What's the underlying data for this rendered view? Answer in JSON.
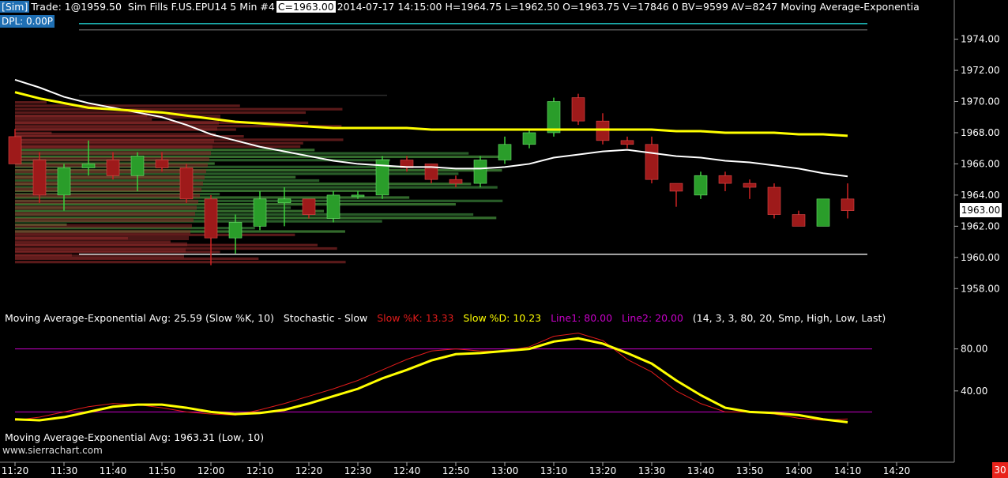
{
  "header": {
    "sim": "[Sim]",
    "trade": "Trade: 1@1959.50",
    "rest": "Sim Fills  F.US.EPU14  5 Min   #4",
    "close": "C=1963.00",
    "stats": "2014-07-17 14:15:00 H=1964.75 L=1962.50 O=1963.75 V=17846 0 BV=9599 AV=8247  Moving Average-Exponentia",
    "dpl": "DPL: 0.00P"
  },
  "indicator_line": {
    "ma": "Moving Average-Exponential  Avg: 25.59   (Slow %K, 10)",
    "stoch": "Stochastic - Slow",
    "k": "Slow %K: 13.33",
    "d": "Slow %D: 10.23",
    "l1": "Line1: 80.00",
    "l2": "Line2: 20.00",
    "params": "(14, 3, 3, 80, 20, Smp, High, Low, Last)"
  },
  "bottom_label": "Moving Average-Exponential  Avg: 1963.31   (Low, 10)",
  "watermark": "www.sierrachart.com",
  "current_price": "1963.00",
  "corner_badge": "30",
  "colors": {
    "up": "#2a9d2a",
    "down": "#9e1a1a",
    "ema_fast": "#ffff00",
    "stoch_k": "#e11b1b",
    "stoch_d": "#ffff00",
    "line1": "#c800c8"
  },
  "chart_data": [
    {
      "type": "candlestick",
      "symbol": "F.US.EPU14",
      "interval": "5 Min",
      "ylim": [
        1957,
        1975.5
      ],
      "y_ticks": [
        "1974.00",
        "1972.00",
        "1970.00",
        "1968.00",
        "1966.00",
        "1964.00",
        "1962.00",
        "1960.00",
        "1958.00"
      ],
      "x_ticks": [
        "11:20",
        "11:30",
        "11:40",
        "11:50",
        "12:00",
        "12:10",
        "12:20",
        "12:30",
        "12:40",
        "12:50",
        "13:00",
        "13:10",
        "13:20",
        "13:30",
        "13:40",
        "13:50",
        "14:00",
        "14:10",
        "14:20"
      ],
      "candles": [
        {
          "t": "11:20",
          "o": 1967.75,
          "h": 1968.25,
          "l": 1966.0,
          "c": 1966.0
        },
        {
          "t": "11:25",
          "o": 1966.25,
          "h": 1966.75,
          "l": 1963.5,
          "c": 1964.0
        },
        {
          "t": "11:30",
          "o": 1964.0,
          "h": 1966.0,
          "l": 1963.0,
          "c": 1965.75
        },
        {
          "t": "11:35",
          "o": 1965.75,
          "h": 1967.5,
          "l": 1965.25,
          "c": 1966.0
        },
        {
          "t": "11:40",
          "o": 1966.25,
          "h": 1966.75,
          "l": 1965.0,
          "c": 1965.25
        },
        {
          "t": "11:45",
          "o": 1965.25,
          "h": 1966.75,
          "l": 1964.25,
          "c": 1966.5
        },
        {
          "t": "11:50",
          "o": 1966.25,
          "h": 1966.75,
          "l": 1965.5,
          "c": 1965.75
        },
        {
          "t": "11:55",
          "o": 1965.75,
          "h": 1966.0,
          "l": 1963.5,
          "c": 1963.75
        },
        {
          "t": "12:00",
          "o": 1963.75,
          "h": 1964.0,
          "l": 1959.5,
          "c": 1961.25
        },
        {
          "t": "12:05",
          "o": 1961.25,
          "h": 1962.75,
          "l": 1960.25,
          "c": 1962.25
        },
        {
          "t": "12:10",
          "o": 1962.0,
          "h": 1964.25,
          "l": 1961.75,
          "c": 1963.75
        },
        {
          "t": "12:15",
          "o": 1963.5,
          "h": 1964.5,
          "l": 1962.0,
          "c": 1963.75
        },
        {
          "t": "12:20",
          "o": 1963.75,
          "h": 1963.75,
          "l": 1962.5,
          "c": 1962.75
        },
        {
          "t": "12:25",
          "o": 1962.5,
          "h": 1964.25,
          "l": 1962.25,
          "c": 1964.0
        },
        {
          "t": "12:30",
          "o": 1964.0,
          "h": 1964.25,
          "l": 1963.75,
          "c": 1964.0
        },
        {
          "t": "12:35",
          "o": 1964.0,
          "h": 1966.5,
          "l": 1963.75,
          "c": 1966.25
        },
        {
          "t": "12:40",
          "o": 1966.25,
          "h": 1966.5,
          "l": 1965.5,
          "c": 1965.75
        },
        {
          "t": "12:45",
          "o": 1966.0,
          "h": 1966.0,
          "l": 1964.75,
          "c": 1965.0
        },
        {
          "t": "12:50",
          "o": 1965.0,
          "h": 1965.25,
          "l": 1964.5,
          "c": 1964.75
        },
        {
          "t": "12:55",
          "o": 1964.75,
          "h": 1966.5,
          "l": 1964.5,
          "c": 1966.25
        },
        {
          "t": "13:00",
          "o": 1966.25,
          "h": 1967.75,
          "l": 1966.0,
          "c": 1967.25
        },
        {
          "t": "13:05",
          "o": 1967.25,
          "h": 1968.25,
          "l": 1967.0,
          "c": 1968.0
        },
        {
          "t": "13:10",
          "o": 1968.0,
          "h": 1970.25,
          "l": 1967.75,
          "c": 1970.0
        },
        {
          "t": "13:15",
          "o": 1970.25,
          "h": 1970.5,
          "l": 1968.5,
          "c": 1968.75
        },
        {
          "t": "13:20",
          "o": 1968.75,
          "h": 1969.25,
          "l": 1967.25,
          "c": 1967.5
        },
        {
          "t": "13:25",
          "o": 1967.5,
          "h": 1967.75,
          "l": 1967.0,
          "c": 1967.25
        },
        {
          "t": "13:30",
          "o": 1967.25,
          "h": 1967.75,
          "l": 1964.75,
          "c": 1965.0
        },
        {
          "t": "13:35",
          "o": 1964.75,
          "h": 1964.75,
          "l": 1963.25,
          "c": 1964.25
        },
        {
          "t": "13:40",
          "o": 1964.0,
          "h": 1965.5,
          "l": 1963.75,
          "c": 1965.25
        },
        {
          "t": "13:45",
          "o": 1965.25,
          "h": 1965.5,
          "l": 1964.25,
          "c": 1964.75
        },
        {
          "t": "13:50",
          "o": 1964.75,
          "h": 1965.0,
          "l": 1963.75,
          "c": 1964.5
        },
        {
          "t": "13:55",
          "o": 1964.5,
          "h": 1964.75,
          "l": 1962.5,
          "c": 1962.75
        },
        {
          "t": "14:00",
          "o": 1962.75,
          "h": 1963.0,
          "l": 1962.0,
          "c": 1962.0
        },
        {
          "t": "14:05",
          "o": 1962.0,
          "h": 1963.75,
          "l": 1962.0,
          "c": 1963.75
        },
        {
          "t": "14:10",
          "o": 1963.75,
          "h": 1964.75,
          "l": 1962.5,
          "c": 1963.0
        }
      ],
      "ema_fast": [
        1970.6,
        1970.2,
        1969.9,
        1969.6,
        1969.5,
        1969.4,
        1969.3,
        1969.1,
        1968.9,
        1968.7,
        1968.6,
        1968.5,
        1968.4,
        1968.3,
        1968.3,
        1968.3,
        1968.3,
        1968.2,
        1968.2,
        1968.2,
        1968.2,
        1968.2,
        1968.2,
        1968.2,
        1968.2,
        1968.2,
        1968.2,
        1968.1,
        1968.1,
        1968.0,
        1968.0,
        1968.0,
        1967.9,
        1967.9,
        1967.8
      ],
      "ema_white": [
        1971.4,
        1970.9,
        1970.3,
        1969.9,
        1969.6,
        1969.3,
        1969.0,
        1968.5,
        1967.9,
        1967.5,
        1967.1,
        1966.8,
        1966.5,
        1966.2,
        1966.0,
        1965.9,
        1965.8,
        1965.8,
        1965.7,
        1965.7,
        1965.8,
        1966.0,
        1966.4,
        1966.6,
        1966.8,
        1966.9,
        1966.7,
        1966.5,
        1966.4,
        1966.2,
        1966.1,
        1965.9,
        1965.7,
        1965.4,
        1965.2
      ],
      "stochastic": {
        "ylim": [
          0,
          100
        ],
        "y_ticks": [
          "80.00",
          "40.00"
        ],
        "line1": 80,
        "line2": 20,
        "slow_k": [
          12,
          15,
          20,
          25,
          28,
          27,
          24,
          20,
          18,
          17,
          22,
          28,
          35,
          42,
          50,
          60,
          70,
          78,
          80,
          78,
          78,
          82,
          92,
          95,
          88,
          70,
          58,
          40,
          28,
          20,
          20,
          18,
          14,
          12,
          13.33
        ],
        "slow_d": [
          13,
          12,
          15,
          20,
          25,
          27,
          27,
          24,
          20,
          18,
          19,
          22,
          28,
          35,
          42,
          52,
          60,
          69,
          75,
          76,
          78,
          80,
          87,
          90,
          85,
          76,
          66,
          50,
          36,
          24,
          20,
          19,
          17,
          13,
          10.23
        ]
      }
    }
  ]
}
